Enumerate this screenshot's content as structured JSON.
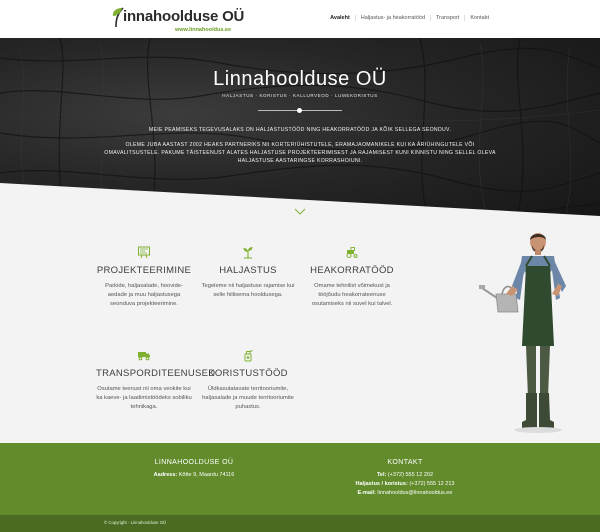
{
  "colors": {
    "brand_green": "#628b2c",
    "footer_dark": "#4a6b21",
    "hero_bg": "#222222"
  },
  "header": {
    "logo_name": "innahoolduse OÜ",
    "logo_url": "www.linnahooldus.ee",
    "nav": [
      "Avaleht",
      "Haljastus- ja heakorratööd",
      "Transport",
      "Kontakt"
    ]
  },
  "hero": {
    "title": "Linnahoolduse OÜ",
    "subtitle": "HALJASTUS · KORISTUS · KALLURVEOD · LUMEKORISTUS",
    "paragraph1": "MEIE PEAMISEKS TEGEVUSALAKS ON HALJASTUSTÖÖD NING HEAKORRATÖÖD JA KÕIK SELLEGA SEONDUV.",
    "paragraph2": "OLEME JUBA AASTAST 2002 HEAKS PARTNERIKS NII KORTERIÜHISTUTELE, ERAMAJAOMANIKELE KUI KA ÄRIÜHINGUTELE VÕI OMAVALITSUSTELE. PAKUME TÄISTEENUST ALATES HALJASTUSE PROJEKTEERIMISEST JA RAJAMISEST KUNI KINNISTU NING SELLEL OLEVA HALJASTUSE AASTARINGSE KORRASHOIUNI."
  },
  "services": [
    {
      "icon": "blueprint-icon",
      "title": "PROJEKTEERIMINE",
      "desc": "Parkide, haljasalade, hoovide-aedade ja muu haljastusega seonduva projekteerimine."
    },
    {
      "icon": "seedling-icon",
      "title": "HALJASTUS",
      "desc": "Tegeleme nii haljastuse rajamise kui selle hiilisema hooldusega."
    },
    {
      "icon": "tractor-icon",
      "title": "HEAKORRATÖÖD",
      "desc": "Omame tehnilist võimekust ja tööjõudu heakorrateenuse osutamiseks nii suvel kui talvel."
    },
    {
      "icon": "truck-icon",
      "title": "TRANSPORDITEENUSED",
      "desc": "Osutame teenust nii oma veokite kui ka kaeve- ja laadimistöödeks sobiliku tehnikaga."
    },
    {
      "icon": "spray-icon",
      "title": "KORISTUSTÖÖD",
      "desc": "Üldkasutatavate territooriumite, haljasalade ja muude territooriumite puhastus."
    }
  ],
  "footer": {
    "left_title": "LINNAHOOLDUSE OÜ",
    "address_label": "Aadress:",
    "address": "Kõtte 9, Maardu 74116",
    "right_title": "KONTAKT",
    "tel_label": "Tel:",
    "tel": "(+372) 555 12 202",
    "haljastus_label": "Haljastus / koristus:",
    "haljastus_tel": "(+372) 555 12 213",
    "email_label": "E-mail:",
    "email": "linnahooldus@linnahooldus.ee"
  },
  "copyright": "© Copyright - Linnahoolduse OÜ"
}
